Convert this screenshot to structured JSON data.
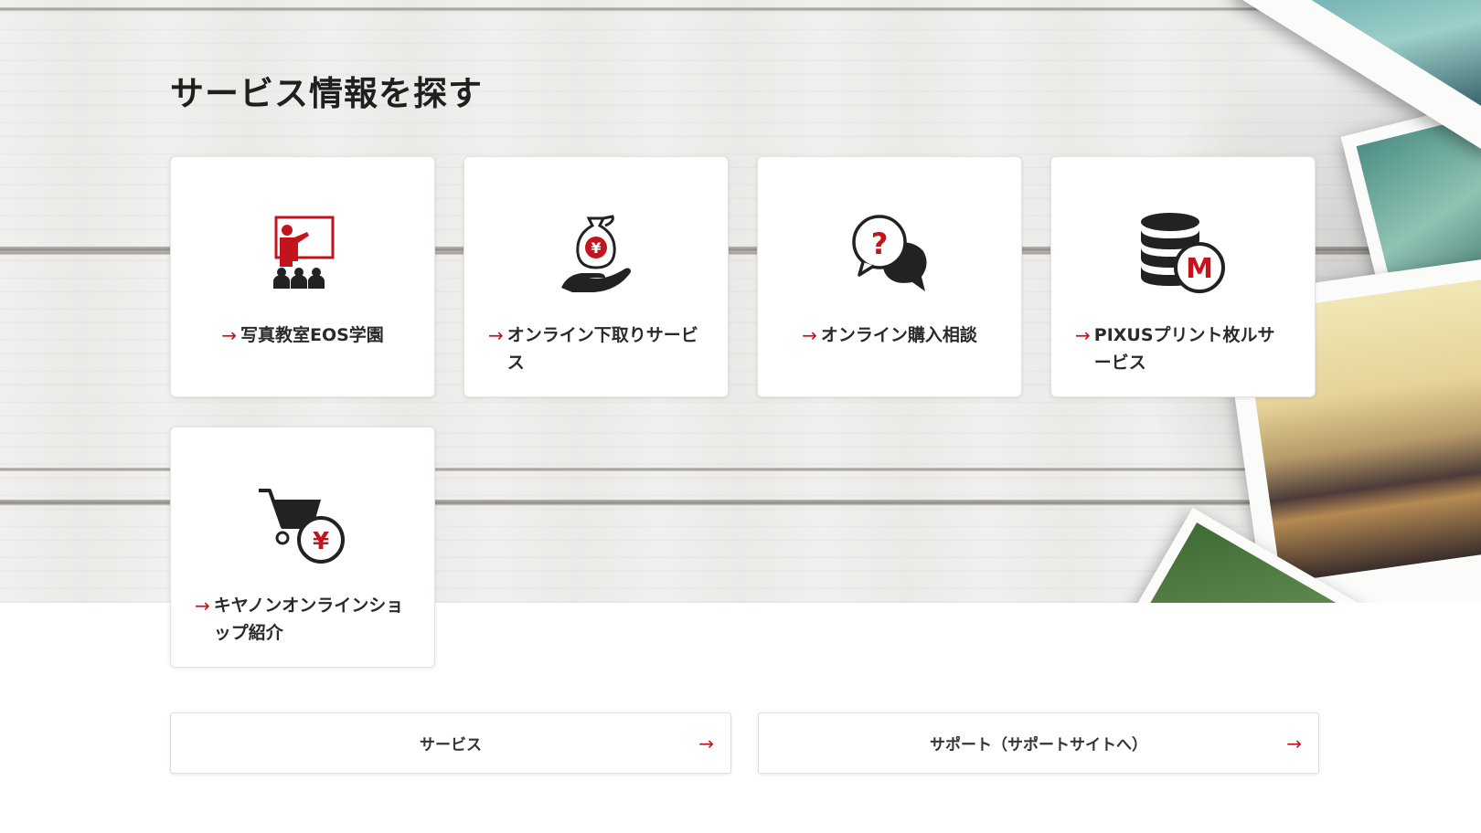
{
  "section": {
    "title": "サービス情報を探す"
  },
  "cards": [
    {
      "label": "写真教室EOS学園",
      "icon": "classroom-teacher-icon"
    },
    {
      "label": "オンライン下取りサービス",
      "icon": "money-bag-hand-icon"
    },
    {
      "label": "オンライン購入相談",
      "icon": "question-chat-bubbles-icon"
    },
    {
      "label": "PIXUSプリント枚ルサービス",
      "icon": "database-m-badge-icon"
    },
    {
      "label": "キヤノンオンラインショップ紹介",
      "icon": "cart-yen-icon"
    }
  ],
  "links": {
    "service": "サービス",
    "support": "サポート（サポートサイトへ）"
  },
  "colors": {
    "accent": "#c4141b",
    "icon_dark": "#222222",
    "text": "#2a2a2a"
  }
}
